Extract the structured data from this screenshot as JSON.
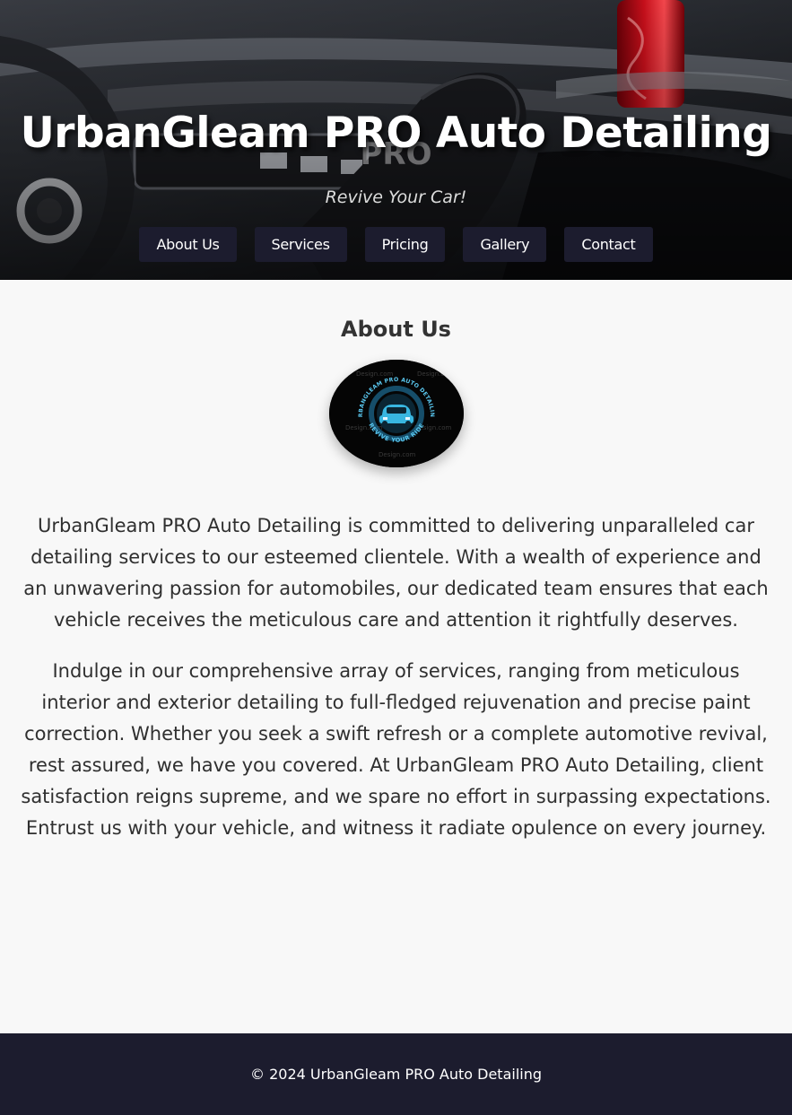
{
  "header": {
    "title": "UrbanGleam PRO Auto Detailing",
    "title_ghost": "PRO",
    "tagline": "Revive Your Car!"
  },
  "nav": {
    "items": [
      {
        "label": "About Us"
      },
      {
        "label": "Services"
      },
      {
        "label": "Pricing"
      },
      {
        "label": "Gallery"
      },
      {
        "label": "Contact"
      }
    ]
  },
  "about": {
    "heading": "About Us",
    "logo": {
      "ring_text_top": "URBANGLEAM PRO AUTO DETAILING",
      "ring_text_bottom": "REVIVE YOUR RIDE",
      "watermark": "Design.com"
    },
    "paragraphs": [
      "UrbanGleam PRO Auto Detailing is committed to delivering unparalleled car detailing services to our esteemed clientele. With a wealth of experience and an unwavering passion for automobiles, our dedicated team ensures that each vehicle receives the meticulous care and attention it rightfully deserves.",
      "Indulge in our comprehensive array of services, ranging from meticulous interior and exterior detailing to full-fledged rejuvenation and precise paint correction. Whether you seek a swift refresh or a complete automotive revival, rest assured, we have you covered. At UrbanGleam PRO Auto Detailing, client satisfaction reigns supreme, and we spare no effort in surpassing expectations. Entrust us with your vehicle, and witness it radiate opulence on every journey."
    ]
  },
  "footer": {
    "copyright": "© 2024 UrbanGleam PRO Auto Detailing"
  },
  "colors": {
    "nav_bg": "#1c1c2e",
    "footer_bg": "#1c1c2e",
    "page_bg": "#f8f8f8",
    "logo_accent": "#38b6e0"
  }
}
